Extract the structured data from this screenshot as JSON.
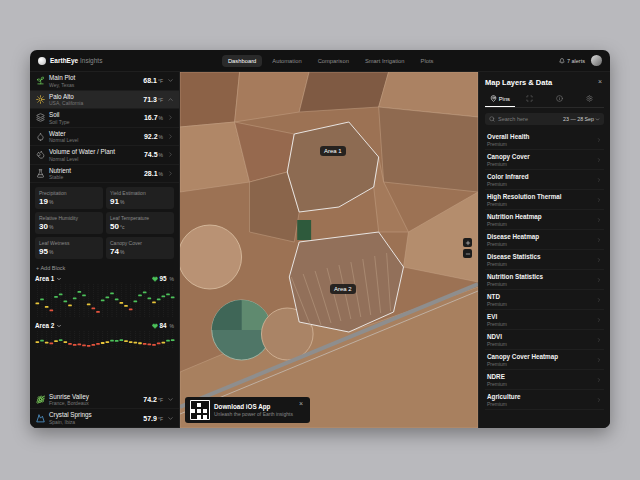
{
  "app": {
    "logo": "EarthEye",
    "logo_suffix": "Insights"
  },
  "nav": [
    {
      "label": "Dashboard",
      "selected": true
    },
    {
      "label": "Automation",
      "selected": false
    },
    {
      "label": "Comparison",
      "selected": false
    },
    {
      "label": "Smart Irrigation",
      "selected": false
    },
    {
      "label": "Plots",
      "selected": false
    }
  ],
  "alerts": "7 alerts",
  "sidebar": {
    "plots": [
      {
        "name": "Main Plot",
        "sub": "Wey, Texas",
        "value": "68.1",
        "unit": "°F",
        "selected": false,
        "expanded": false
      },
      {
        "name": "Palo Alto",
        "sub": "USA, California",
        "value": "71.3",
        "unit": "°F",
        "selected": true,
        "expanded": true
      }
    ],
    "metrics": [
      {
        "name": "Soil",
        "sub": "Soil Type",
        "value": "16.7",
        "unit": "%"
      },
      {
        "name": "Water",
        "sub": "Normal Level",
        "value": "92.2",
        "unit": "%"
      },
      {
        "name": "Volume of Water / Plant",
        "sub": "Normal Level",
        "value": "74.5",
        "unit": "%"
      },
      {
        "name": "Nutrient",
        "sub": "Stable",
        "value": "28.1",
        "unit": "%"
      }
    ],
    "cards": [
      {
        "label": "Precipitation",
        "value": "19",
        "unit": "%"
      },
      {
        "label": "Yield Estimation",
        "value": "91",
        "unit": "%"
      },
      {
        "label": "Relative Humidity",
        "value": "30",
        "unit": "%"
      },
      {
        "label": "Leaf Temperature",
        "value": "50",
        "unit": "°c"
      },
      {
        "label": "Leaf Wetness",
        "value": "95",
        "unit": "%"
      },
      {
        "label": "Canopy Cover",
        "value": "74",
        "unit": "%"
      }
    ],
    "add_block": "+ Add Block",
    "areas": [
      {
        "name": "Area 1",
        "score": "95",
        "unit": "%",
        "values": [
          62,
          70,
          55,
          48,
          75,
          80,
          66,
          58,
          72,
          85,
          78,
          60,
          52,
          45,
          68,
          74,
          82,
          70,
          63,
          57,
          50,
          66,
          78,
          84,
          72,
          64,
          70,
          76,
          80,
          74
        ]
      },
      {
        "name": "Area 2",
        "score": "84",
        "unit": "%",
        "values": [
          60,
          66,
          58,
          54,
          64,
          68,
          60,
          52,
          48,
          50,
          46,
          44,
          48,
          52,
          56,
          60,
          66,
          65,
          68,
          64,
          60,
          58,
          55,
          52,
          50,
          48,
          54,
          58,
          66,
          68
        ]
      }
    ],
    "more_plots": [
      {
        "name": "Sunrise Valley",
        "sub": "France, Bordeaux",
        "value": "74.2",
        "unit": "°F",
        "selected": false,
        "expanded": false
      },
      {
        "name": "Crystal Springs",
        "sub": "Spain, Ibiza",
        "value": "57.9",
        "unit": "°F",
        "selected": false,
        "expanded": false
      }
    ]
  },
  "map": {
    "areas": [
      {
        "label": "Area 1"
      },
      {
        "label": "Area 2"
      }
    ],
    "promo": {
      "title": "Download iOS App",
      "subtitle": "Unleash the power of Earth insights",
      "close": "×"
    }
  },
  "panel": {
    "title": "Map Layers & Data",
    "close": "×",
    "tabs": [
      {
        "label": "Pins",
        "selected": true
      },
      {
        "selected": false
      },
      {
        "selected": false
      },
      {
        "selected": false
      }
    ],
    "search": {
      "placeholder": "Search here"
    },
    "date": "23 — 28 Sep",
    "layers": [
      {
        "name": "Overall Health",
        "sub": "Premium"
      },
      {
        "name": "Canopy Cover",
        "sub": "Premium"
      },
      {
        "name": "Color Infrared",
        "sub": "Premium"
      },
      {
        "name": "High Resolution Thermal",
        "sub": "Premium"
      },
      {
        "name": "Nutrition Heatmap",
        "sub": "Premium"
      },
      {
        "name": "Disease Heatmap",
        "sub": "Premium"
      },
      {
        "name": "Disease Statistics",
        "sub": "Premium"
      },
      {
        "name": "Nutrition Statistics",
        "sub": "Premium"
      },
      {
        "name": "NTD",
        "sub": "Premium"
      },
      {
        "name": "EVI",
        "sub": "Premium"
      },
      {
        "name": "NDVI",
        "sub": "Premium"
      },
      {
        "name": "Canopy Cover Heatmap",
        "sub": "Premium"
      },
      {
        "name": "NDRE",
        "sub": "Premium"
      },
      {
        "name": "Agriculture",
        "sub": "Premium"
      }
    ]
  }
}
